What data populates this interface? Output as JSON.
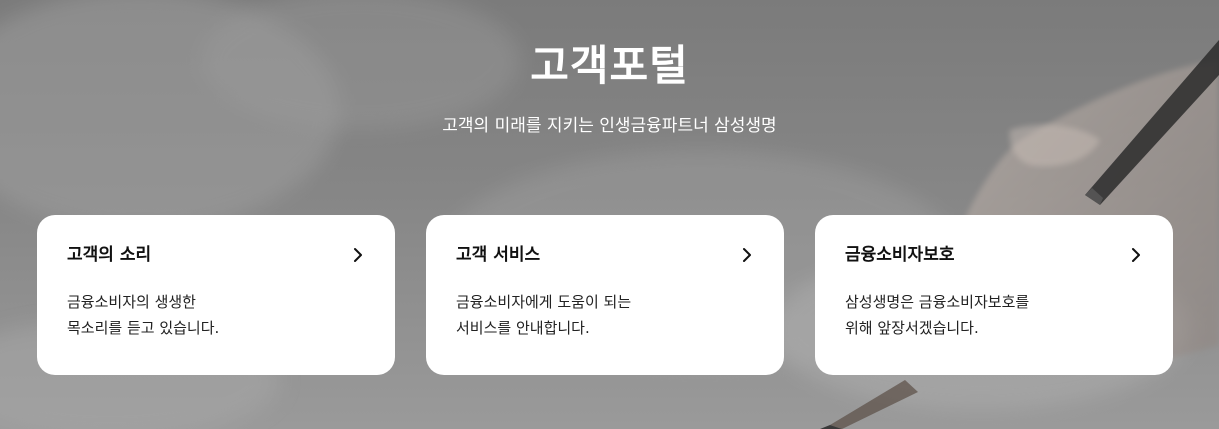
{
  "hero": {
    "title": "고객포털",
    "subtitle": "고객의 미래를 지키는 인생금융파트너 삼성생명"
  },
  "cards": [
    {
      "title": "고객의 소리",
      "desc_line1": "금융소비자의 생생한",
      "desc_line2": "목소리를 듣고 있습니다.",
      "icon": "chevron-right-icon"
    },
    {
      "title": "고객 서비스",
      "desc_line1": "금융소비자에게 도움이 되는",
      "desc_line2": "서비스를 안내합니다.",
      "icon": "chevron-right-icon"
    },
    {
      "title": "금융소비자보호",
      "desc_line1": "삼성생명은 금융소비자보호를",
      "desc_line2": "위해 앞장서겠습니다.",
      "icon": "chevron-right-icon"
    }
  ],
  "colors": {
    "card_background": "#ffffff",
    "hero_text": "#ffffff",
    "card_text": "#111111"
  }
}
